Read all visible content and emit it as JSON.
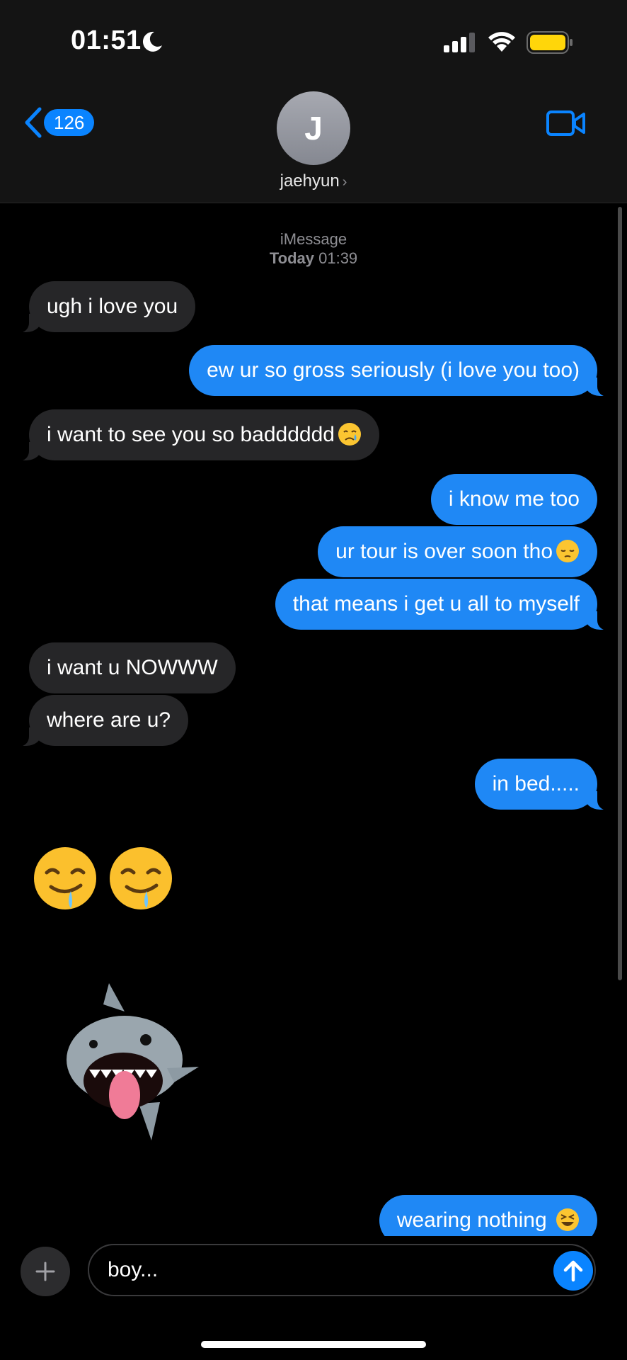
{
  "status_bar": {
    "time": "01:51"
  },
  "header": {
    "back_count": "126",
    "avatar_initial": "J",
    "contact_name": "jaehyun"
  },
  "thread_meta": {
    "service": "iMessage",
    "day": "Today",
    "time": "01:39"
  },
  "messages": [
    {
      "direction": "incoming",
      "text": "ugh i love you"
    },
    {
      "direction": "outgoing",
      "text": "ew ur so gross seriously (i love you too)"
    },
    {
      "direction": "incoming",
      "text": "i want to see you so badddddd",
      "emoji": "crying-face"
    },
    {
      "direction": "outgoing",
      "text": "i know me too"
    },
    {
      "direction": "outgoing",
      "text": "ur tour is over soon tho",
      "emoji": "pensive-face"
    },
    {
      "direction": "outgoing",
      "text": "that means i get u all to myself"
    },
    {
      "direction": "incoming",
      "text": "i want u NOWWW"
    },
    {
      "direction": "incoming",
      "text": "where are u?"
    },
    {
      "direction": "outgoing",
      "text": "in bed....."
    },
    {
      "direction": "incoming",
      "type": "emoji",
      "emoji": [
        "drooling-face",
        "drooling-face"
      ]
    },
    {
      "direction": "incoming",
      "type": "memoji-sticker",
      "emoji": "shark"
    },
    {
      "direction": "outgoing",
      "text": "wearing nothing",
      "emoji": "grinning-squinting-face"
    }
  ],
  "composer": {
    "text": "boy..."
  },
  "icons": {
    "back": "chevron-left-icon",
    "video": "video-camera-icon",
    "add": "plus-icon",
    "send": "arrow-up-icon",
    "moon": "moon-icon",
    "signal": "signal-icon",
    "wifi": "wifi-icon",
    "battery": "battery-icon"
  },
  "colors": {
    "accent": "#0a84ff",
    "outgoing_bubble": "#1f88f5",
    "incoming_bubble": "#262628",
    "battery_fill": "#ffd60a"
  }
}
